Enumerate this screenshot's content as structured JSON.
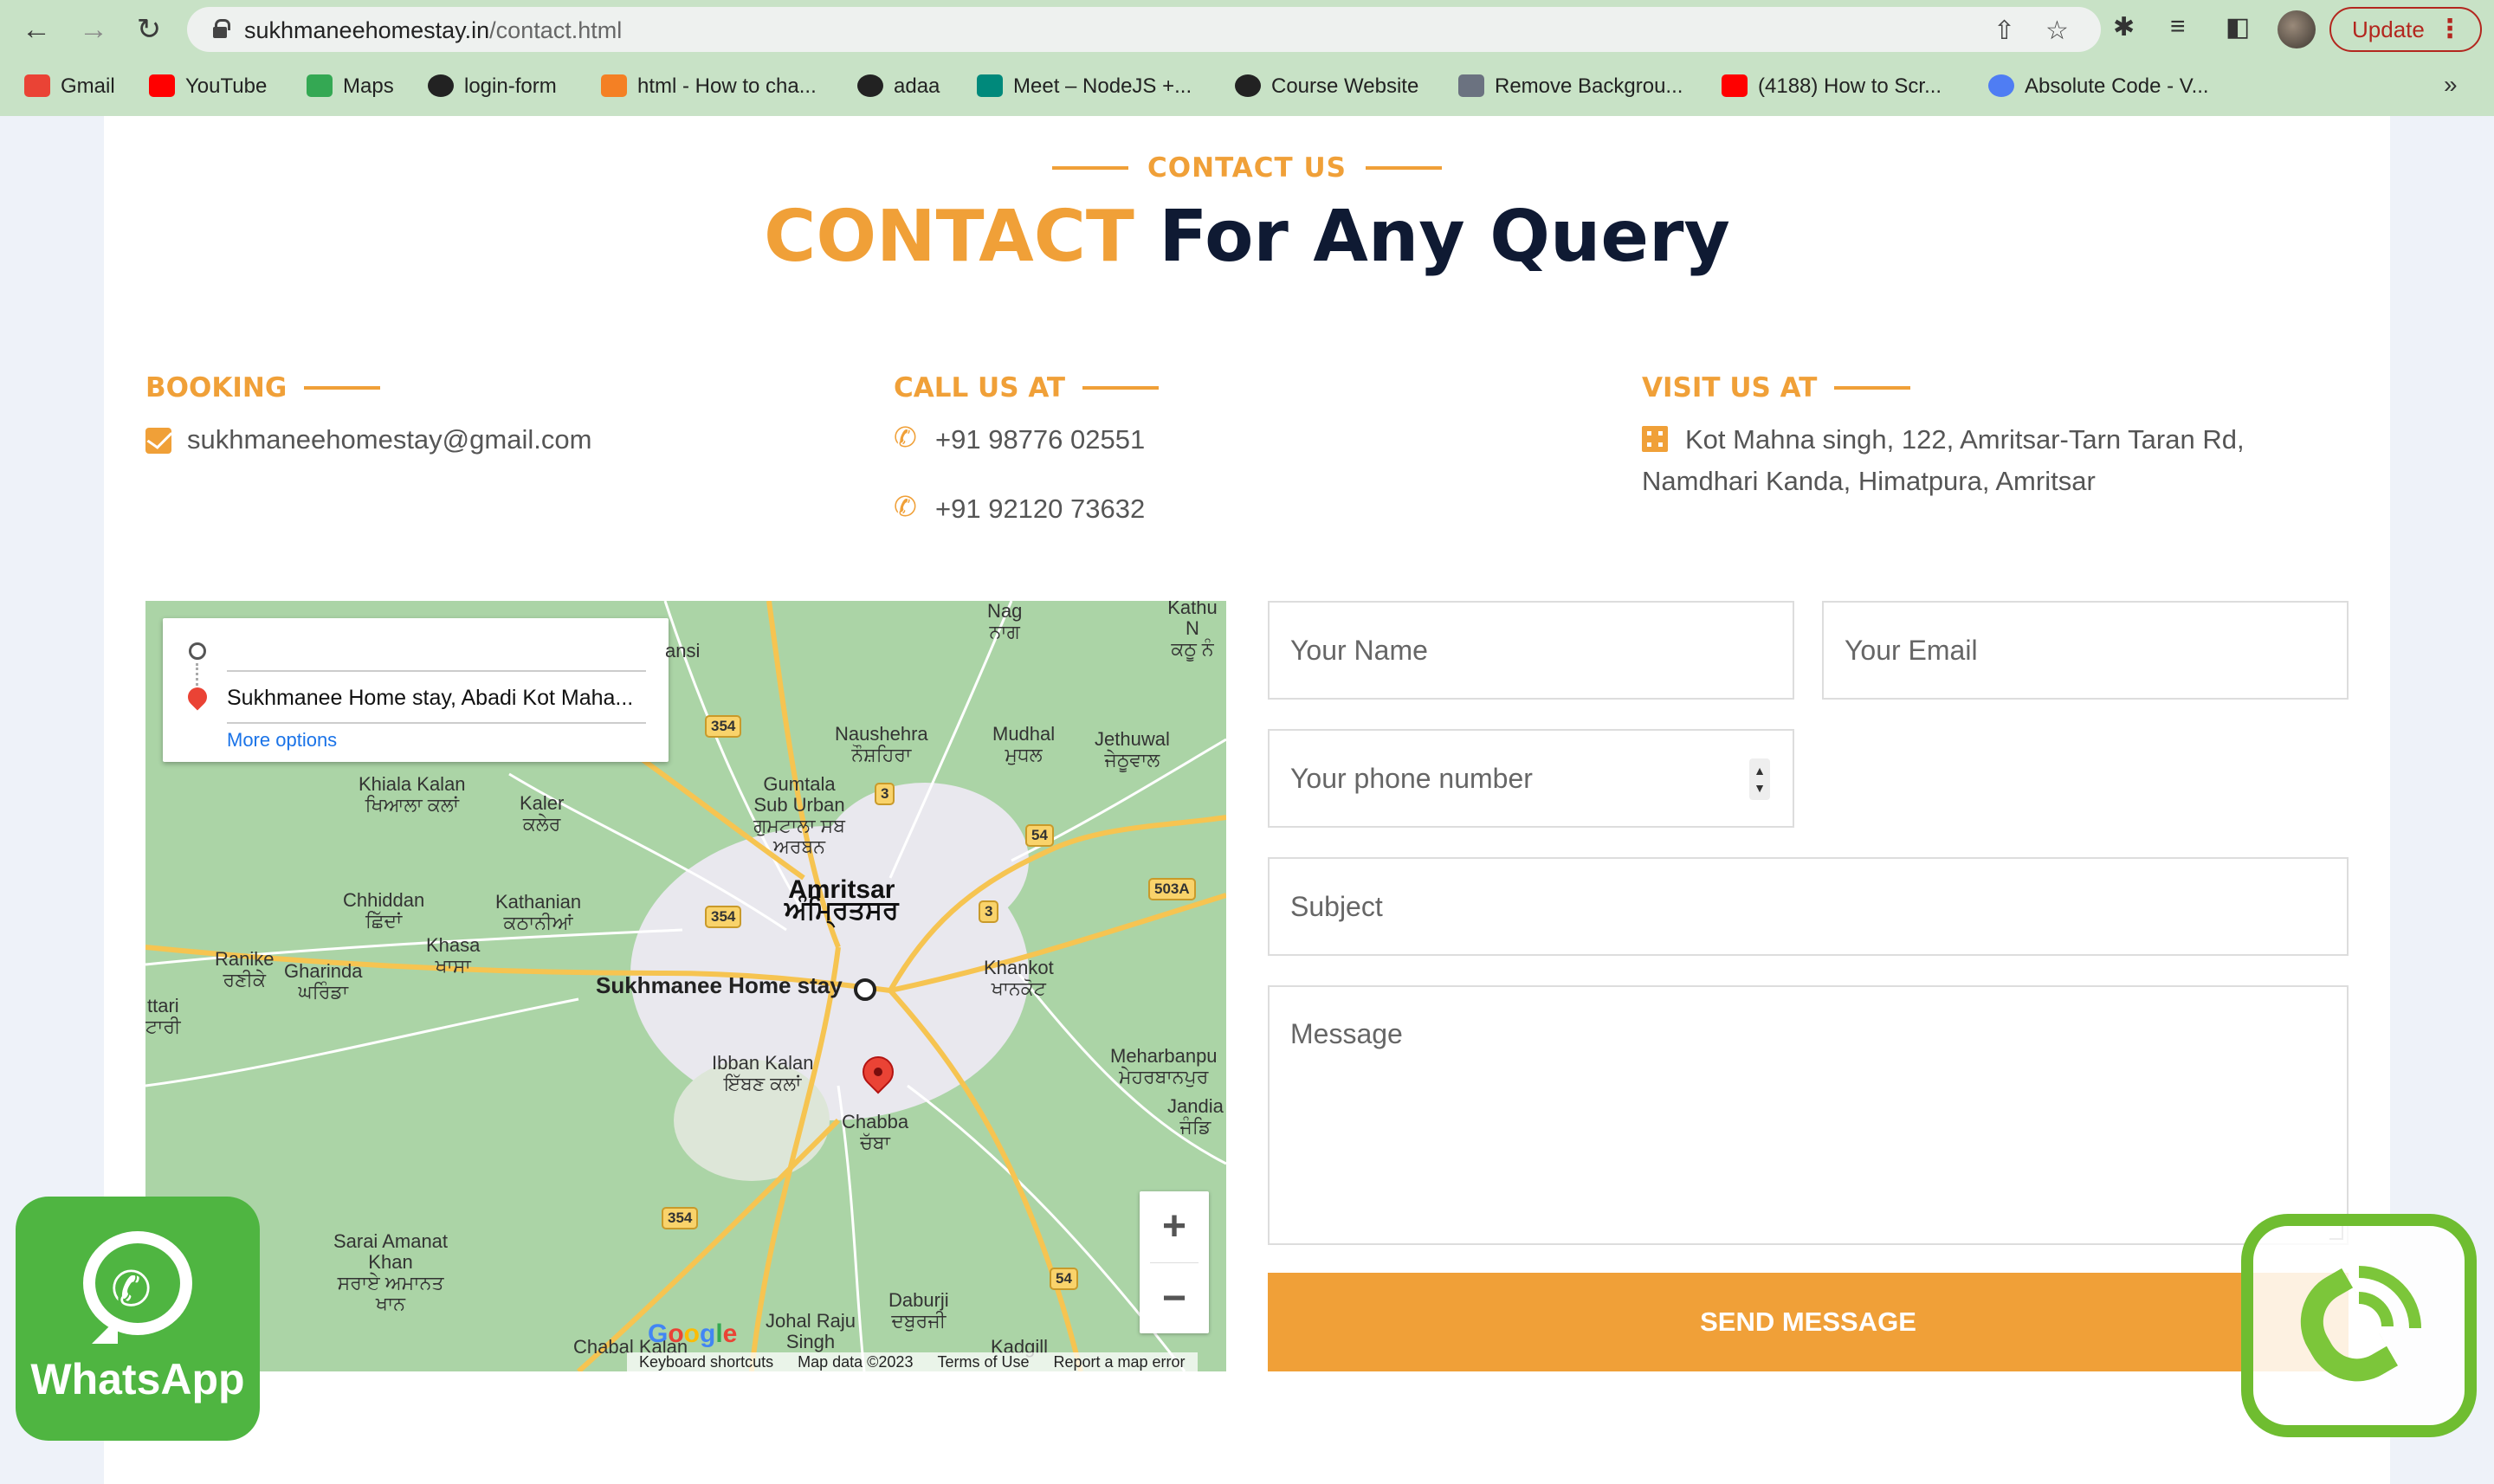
{
  "browser": {
    "url_host": "sukhmaneehomestay.in",
    "url_path": "/contact.html",
    "update_label": "Update",
    "bookmarks": [
      {
        "label": "Gmail",
        "color": "#ea4335"
      },
      {
        "label": "YouTube",
        "color": "#ff0000"
      },
      {
        "label": "Maps",
        "color": "#34a853"
      },
      {
        "label": "login-form",
        "color": "#222222"
      },
      {
        "label": "html - How to cha...",
        "color": "#f48024"
      },
      {
        "label": "adaa",
        "color": "#222222"
      },
      {
        "label": "Meet – NodeJS +...",
        "color": "#00897b"
      },
      {
        "label": "Course Website",
        "color": "#222222"
      },
      {
        "label": "Remove Backgrou...",
        "color": "#6b7280"
      },
      {
        "label": "(4188) How to Scr...",
        "color": "#ff0000"
      },
      {
        "label": "Absolute Code - V...",
        "color": "#4f7df3"
      }
    ],
    "more_label": "»"
  },
  "header": {
    "eyebrow": "CONTACT US",
    "title_accent": "CONTACT",
    "title_rest": "For Any Query"
  },
  "info": {
    "booking": {
      "title": "BOOKING",
      "email": "sukhmaneehomestay@gmail.com"
    },
    "call": {
      "title": "CALL US AT",
      "phone1": "+91 98776 02551",
      "phone2": "+91 92120 73632"
    },
    "visit": {
      "title": "VISIT US AT",
      "line1": "Kot Mahna singh, 122, Amritsar-Tarn Taran Rd,",
      "line2": "Namdhari Kanda, Himatpura, Amritsar"
    }
  },
  "map": {
    "destination": "Sukhmanee Home stay, Abadi Kot Maha...",
    "more_options": "More options",
    "place_label": "Sukhmanee Home stay",
    "city_en": "Amritsar",
    "city_pa": "ਅੰਮ੍ਰਿਤਸਰ",
    "places": [
      {
        "name": "Naushehra",
        "sub": "ਨੌਸ਼ਹਿਰਾ"
      },
      {
        "name": "Mudhal",
        "sub": "ਮੁਧਲ"
      },
      {
        "name": "Jethuwal",
        "sub": "ਜੇਠੂਵਾਲ"
      },
      {
        "name": "Khiala Kalan",
        "sub": "ਖਿਆਲਾ ਕਲਾਂ"
      },
      {
        "name": "Kaler",
        "sub": "ਕਲੇਰ"
      },
      {
        "name": "Gumtala Sub Urban",
        "sub": "ਗੁਮਟਾਲਾ ਸਬ ਅਰਬਨ"
      },
      {
        "name": "Chhiddan",
        "sub": "ਛਿੱਦਾਂ"
      },
      {
        "name": "Kathanian",
        "sub": "ਕਠਾਨੀਆਂ"
      },
      {
        "name": "Ranike",
        "sub": "ਰਣੀਕੇ"
      },
      {
        "name": "Gharinda",
        "sub": "ਘਰਿੰਡਾ"
      },
      {
        "name": "Khasa",
        "sub": "ਖਾਸਾ"
      },
      {
        "name": "Khankot",
        "sub": "ਖਾਨਕੋਟ"
      },
      {
        "name": "Ibban Kalan",
        "sub": "ਇੱਬਣ ਕਲਾਂ"
      },
      {
        "name": "Meharbanpu",
        "sub": "ਮੇਹਰਬਾਨਪੁਰ"
      },
      {
        "name": "Chabba",
        "sub": "ਚੱਬਾ"
      },
      {
        "name": "Jandia",
        "sub": "ਜੰਡਿ"
      },
      {
        "name": "Sarai Amanat Khan",
        "sub": "ਸਰਾਏ ਅਮਾਨਤ ਖਾਨ"
      },
      {
        "name": "Johal Raju Singh",
        "sub": ""
      },
      {
        "name": "Daburji",
        "sub": "ਦਬੁਰਜੀ"
      },
      {
        "name": "Chabal Kalan",
        "sub": ""
      },
      {
        "name": "Kadgill",
        "sub": ""
      },
      {
        "name": "Nag",
        "sub": "ਨਾਗ"
      },
      {
        "name": "Kathu N",
        "sub": "ਕਠੂ ਨੰ"
      },
      {
        "name": "ansi",
        "sub": ""
      },
      {
        "name": "ttari",
        "sub": "ਟਾਰੀ"
      }
    ],
    "shields": [
      "354",
      "3",
      "54",
      "503A",
      "354",
      "3",
      "354",
      "54"
    ],
    "footer": [
      "Keyboard shortcuts",
      "Map data ©2023",
      "Terms of Use",
      "Report a map error"
    ],
    "google": "Google",
    "zoom_in": "+",
    "zoom_out": "−"
  },
  "form": {
    "name_placeholder": "Your Name",
    "email_placeholder": "Your Email",
    "phone_placeholder": "Your phone number",
    "subject_placeholder": "Subject",
    "message_placeholder": "Message",
    "send_label": "SEND MESSAGE"
  },
  "widgets": {
    "whatsapp_label": "WhatsApp"
  },
  "colors": {
    "accent": "#f0a038",
    "heading": "#0f1a33",
    "whatsapp": "#4fb541",
    "chrome": "#c8e2c6"
  }
}
